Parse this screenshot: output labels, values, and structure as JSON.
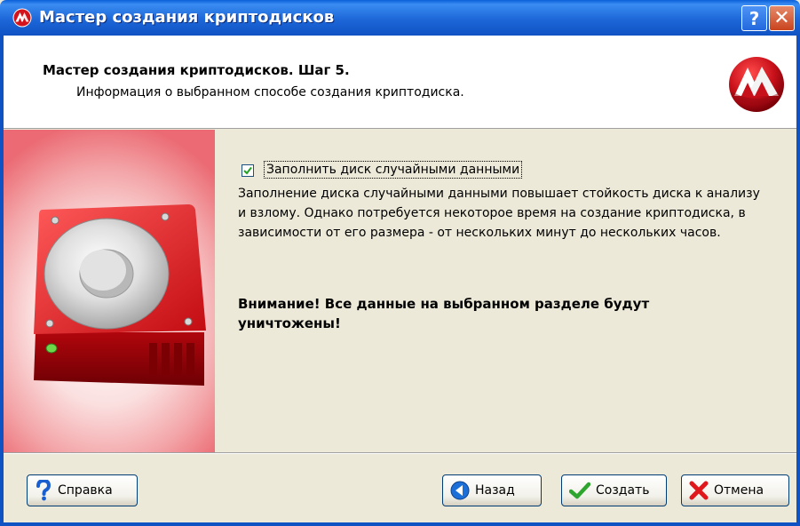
{
  "window": {
    "title": "Мастер создания криптодисков"
  },
  "header": {
    "title": "Мастер создания криптодисков. Шаг 5.",
    "subtitle": "Информация о выбранном способе создания криптодиска."
  },
  "content": {
    "checkbox_label": "Заполнить диск случайными данными",
    "checkbox_checked": true,
    "description": "Заполнение диска случайными данными повышает стойкость диска к анализу и взлому. Однако потребуется некоторое время на создание криптодиска, в зависимости от его размера - от нескольких минут до нескольких часов.",
    "warning": "Внимание! Все данные на выбранном разделе будут уничтожены!"
  },
  "footer": {
    "help_label": "Справка",
    "back_label": "Назад",
    "create_label": "Создать",
    "cancel_label": "Отмена"
  },
  "icons": {
    "title": "app-logo-icon",
    "help": "question-mark-icon",
    "back": "back-arrow-icon",
    "create": "checkmark-icon",
    "cancel": "red-x-icon",
    "side": "red-hard-drive-icon"
  },
  "colors": {
    "titlebar": "#1d67d8",
    "accent_red": "#d4141c",
    "dialog_bg": "#ece9d8"
  }
}
